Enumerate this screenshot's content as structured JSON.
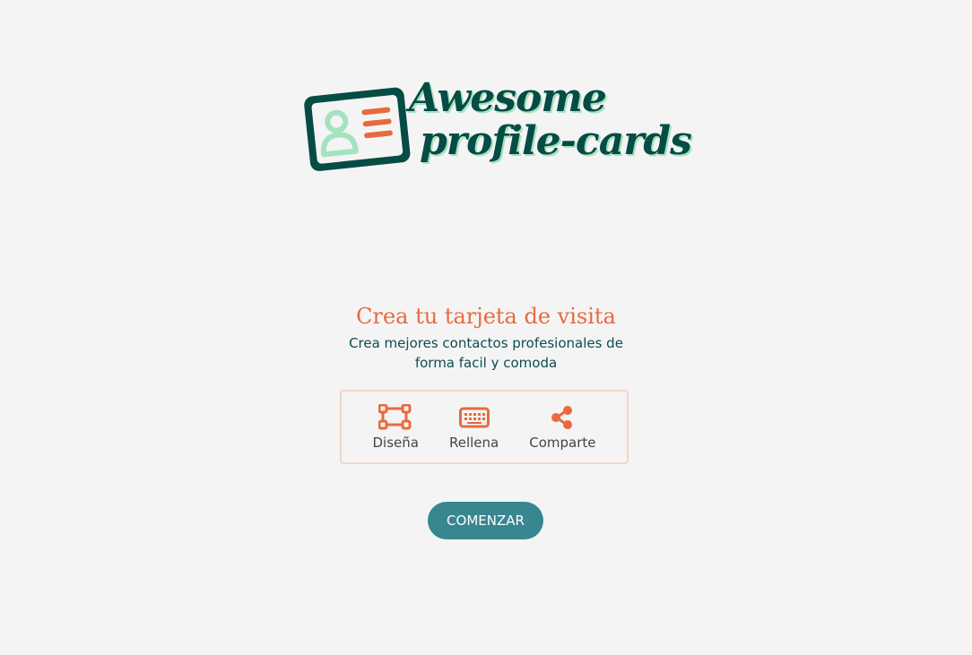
{
  "colors": {
    "background": "#f4f4f4",
    "brand_dark": "#054c45",
    "brand_light": "#a4e3bf",
    "accent": "#e86a3e",
    "button": "#378690"
  },
  "logo": {
    "line1": "Awesome",
    "line2": "profile-cards",
    "icon": "id-card-icon"
  },
  "hero": {
    "title": "Crea tu tarjeta de visita",
    "subtitle": "Crea mejores contactos profesionales de forma facil y comoda"
  },
  "steps": [
    {
      "icon": "design-vector-icon",
      "label": "Diseña"
    },
    {
      "icon": "keyboard-icon",
      "label": "Rellena"
    },
    {
      "icon": "share-icon",
      "label": "Comparte"
    }
  ],
  "cta": {
    "label": "COMENZAR"
  }
}
